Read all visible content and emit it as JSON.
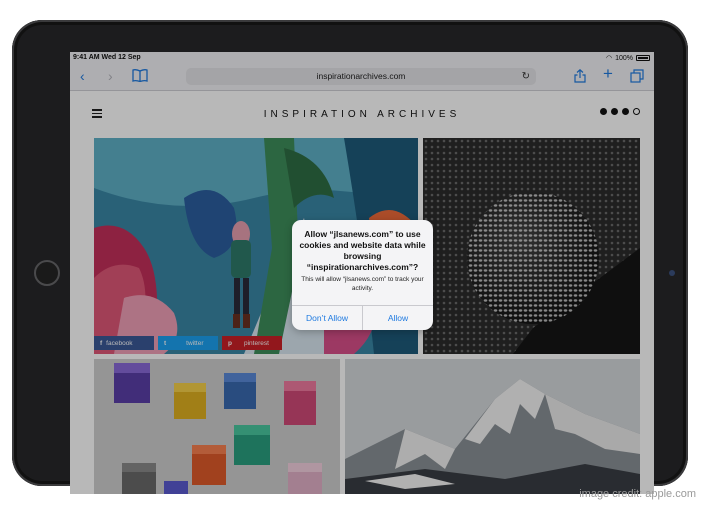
{
  "status": {
    "time": "9:41 AM",
    "date": "Wed 12 Sep",
    "battery": "100%"
  },
  "toolbar": {
    "url": "inspirationarchives.com",
    "back_icon": "chevron-left-icon",
    "forward_icon": "chevron-right-icon",
    "bookmarks_icon": "book-icon",
    "reload_icon": "reload-icon",
    "share_icon": "share-icon",
    "add_icon": "plus-icon",
    "tabs_icon": "tabs-icon"
  },
  "site": {
    "title": "INSPIRATION ARCHIVES"
  },
  "share": {
    "facebook": "facebook",
    "twitter": "twitter",
    "pinterest": "pinterest",
    "fb_glyph": "f",
    "tw_glyph": "t",
    "pi_glyph": "p"
  },
  "alert": {
    "title": "Allow “jlsanews.com” to use cookies and website data while browsing “inspirationarchives.com”?",
    "message": "This will allow “jlsanews.com” to track your activity.",
    "deny": "Don’t Allow",
    "allow": "Allow"
  },
  "credit": "image credit: apple.com"
}
